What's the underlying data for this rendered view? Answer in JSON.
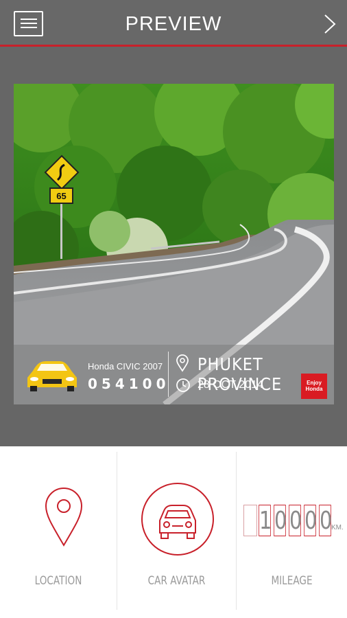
{
  "header": {
    "title": "PREVIEW",
    "menu_icon": "hamburger-icon",
    "next_icon": "chevron-right-icon"
  },
  "preview": {
    "road_sign_speed": "65",
    "car_model": "Honda CIVIC 2007",
    "odometer": "054100",
    "location": "PHUKET PROVINCE",
    "date": "28 OCT 2014",
    "brand_logo_text": "Enjoy Honda"
  },
  "options": [
    {
      "label": "LOCATION",
      "icon": "map-pin-icon"
    },
    {
      "label": "CAR AVATAR",
      "icon": "car-icon"
    },
    {
      "label": "MILEAGE",
      "icon": "odometer-icon",
      "digits": [
        "1",
        "0",
        "0",
        "0",
        "0"
      ],
      "unit": "KM."
    }
  ],
  "colors": {
    "accent": "#c8202a",
    "header_bg": "#686868",
    "background": "#666666",
    "car_yellow": "#f3c514"
  }
}
